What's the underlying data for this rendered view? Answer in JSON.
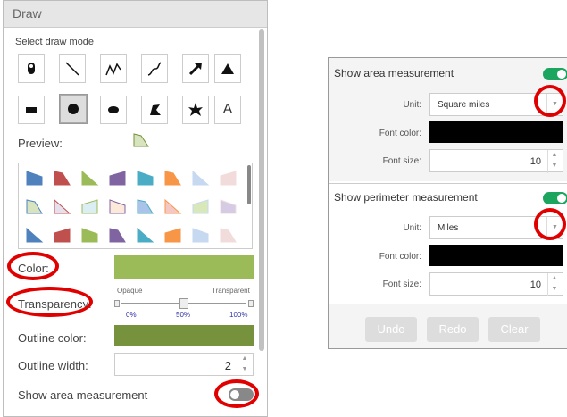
{
  "draw": {
    "title": "Draw",
    "select_mode_label": "Select draw mode",
    "tools": [
      "point",
      "line",
      "polyline",
      "freehand-line",
      "arrow",
      "triangle",
      "rectangle",
      "circle",
      "ellipse",
      "polygon",
      "freehand-polygon",
      "text"
    ],
    "text_tool_label": "A",
    "preview_label": "Preview:",
    "color_label": "Color:",
    "transparency_label": "Transparency:",
    "opaque_label": "Opaque",
    "transparent_label": "Transparent",
    "tick_0": "0%",
    "tick_50": "50%",
    "tick_100": "100%",
    "transparency_value": 0.5,
    "outline_color_label": "Outline color:",
    "outline_width_label": "Outline width:",
    "outline_width_value": "2",
    "show_area_label": "Show area measurement",
    "show_area_on": false,
    "fill_color": "#9bbb59",
    "outline_color": "#76923c",
    "symbol_colors": [
      "#4f81bd",
      "#c0504d",
      "#9bbb59",
      "#8064a2",
      "#4bacc6",
      "#f79646",
      "#c6d9f1",
      "#f2dcdb",
      "#d7e4bd",
      "#e5e0ec",
      "#dbeef4",
      "#fde9d9",
      "#a9c4e8",
      "#f4c7c5",
      "#d8e8b9",
      "#d5cbe5"
    ]
  },
  "measure": {
    "show_area_label": "Show area measurement",
    "show_area_on": true,
    "area_unit_label": "Unit:",
    "area_unit_value": "Square miles",
    "area_font_color_label": "Font color:",
    "area_font_size_label": "Font size:",
    "area_font_size_value": "10",
    "show_perimeter_label": "Show perimeter measurement",
    "show_perimeter_on": true,
    "perimeter_unit_label": "Unit:",
    "perimeter_unit_value": "Miles",
    "perimeter_font_color_label": "Font color:",
    "perimeter_font_size_label": "Font size:",
    "perimeter_font_size_value": "10",
    "undo_label": "Undo",
    "redo_label": "Redo",
    "clear_label": "Clear",
    "toggle_on_color": "#1ca55e"
  },
  "annotation_color": "#e00000"
}
